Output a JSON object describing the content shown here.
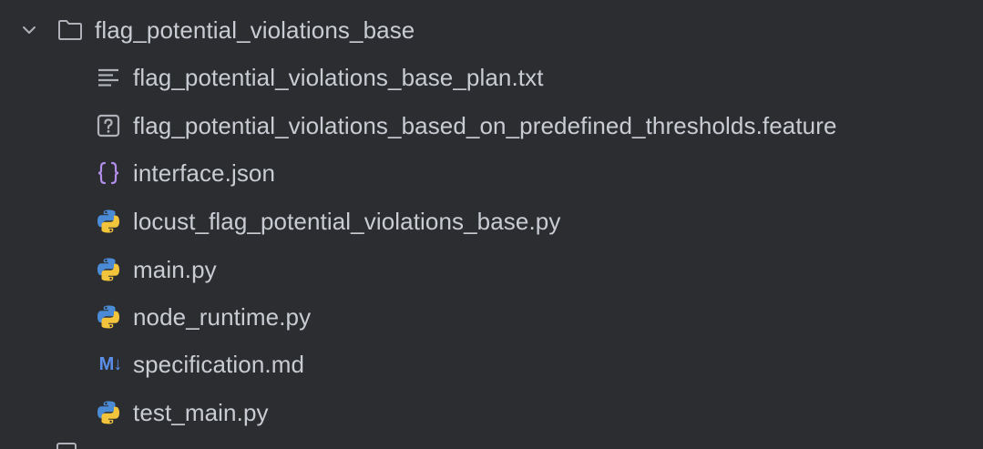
{
  "folder": {
    "name": "flag_potential_violations_base",
    "expanded": true,
    "icon": "folder-icon",
    "toggle_icon": "chevron-down-icon"
  },
  "files": [
    {
      "name": "flag_potential_violations_base_plan.txt",
      "icon": "text-file-icon"
    },
    {
      "name": "flag_potential_violations_based_on_predefined_thresholds.feature",
      "icon": "unknown-file-icon"
    },
    {
      "name": "interface.json",
      "icon": "json-icon"
    },
    {
      "name": "locust_flag_potential_violations_base.py",
      "icon": "python-icon"
    },
    {
      "name": "main.py",
      "icon": "python-icon"
    },
    {
      "name": "node_runtime.py",
      "icon": "python-icon"
    },
    {
      "name": "specification.md",
      "icon": "markdown-icon",
      "icon_text": "M↓"
    },
    {
      "name": "test_main.py",
      "icon": "python-icon"
    }
  ],
  "colors": {
    "background": "#2b2d30",
    "text": "#c9ccd3",
    "icon_gray": "#aeb1b8",
    "json_purple": "#b38eeb",
    "python_blue": "#4b8bd6",
    "python_yellow": "#f2c43c",
    "markdown_blue": "#5a8ee8"
  }
}
